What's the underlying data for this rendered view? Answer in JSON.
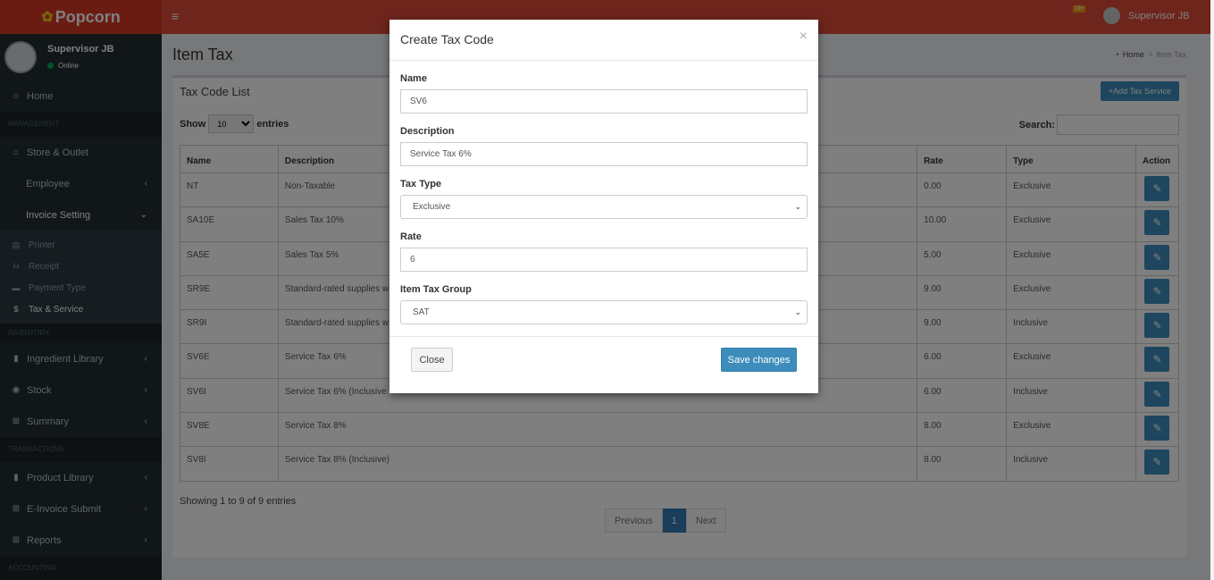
{
  "brand": {
    "name": "Popcorn",
    "icon": "popcorn-icon"
  },
  "topbar": {
    "menu_icon": "≡",
    "badge": "18+",
    "user_name": "Supervisor JB"
  },
  "sidebar": {
    "user": {
      "name": "Supervisor JB",
      "status": "Online"
    },
    "home": "Home",
    "sections": {
      "management": "MANAGEMENT",
      "inventory": "INVENTORY",
      "transactions": "TRANSACTIONS",
      "accounting": "ACCOUNTING"
    },
    "store_outlet": "Store & Outlet",
    "employee": "Employee",
    "invoice_setting": "Invoice Setting",
    "invoice_children": [
      {
        "label": "Printer",
        "icon": "printer-icon"
      },
      {
        "label": "Receipt",
        "icon": "header-icon"
      },
      {
        "label": "Payment Type",
        "icon": "card-icon"
      },
      {
        "label": "Tax & Service",
        "icon": "dollar-icon"
      }
    ],
    "ingredient_library": "Ingredient Library",
    "stock": "Stock",
    "summary": "Summary",
    "product_library": "Product Library",
    "einvoice_submit": "E-Invoice Submit",
    "reports": "Reports"
  },
  "page": {
    "title": "Item Tax",
    "breadcrumb": {
      "home": "Home",
      "sep": ">",
      "current": "Item Tax"
    }
  },
  "list": {
    "title": "Tax Code List",
    "add_button": "Add Tax Service",
    "show_label": "Show",
    "entries_value": "10",
    "entries_label": "entries",
    "search_label": "Search:",
    "columns": [
      "Name",
      "Description",
      "Rate",
      "Type",
      "Action"
    ],
    "rows": [
      {
        "name": "NT",
        "description": "Non-Taxable",
        "rate": "0.00",
        "type": "Exclusive"
      },
      {
        "name": "SA10E",
        "description": "Sales Tax 10%",
        "rate": "10.00",
        "type": "Exclusive"
      },
      {
        "name": "SA5E",
        "description": "Sales Tax 5%",
        "rate": "5.00",
        "type": "Exclusive"
      },
      {
        "name": "SR9E",
        "description": "Standard-rated supplies w",
        "rate": "9.00",
        "type": "Exclusive"
      },
      {
        "name": "SR9I",
        "description": "Standard-rated supplies w",
        "rate": "9.00",
        "type": "Inclusive"
      },
      {
        "name": "SV6E",
        "description": "Service Tax 6%",
        "rate": "6.00",
        "type": "Exclusive"
      },
      {
        "name": "SV6I",
        "description": "Service Tax 6% (Inclusive",
        "rate": "6.00",
        "type": "Inclusive"
      },
      {
        "name": "SV8E",
        "description": "Service Tax 8%",
        "rate": "8.00",
        "type": "Exclusive"
      },
      {
        "name": "SV8I",
        "description": "Service Tax 8% (Inclusive)",
        "rate": "8.00",
        "type": "Inclusive"
      }
    ],
    "info": "Showing 1 to 9 of 9 entries",
    "pagination": {
      "previous": "Previous",
      "current": "1",
      "next": "Next"
    }
  },
  "modal": {
    "title": "Create Tax Code",
    "close_x": "×",
    "fields": {
      "name": {
        "label": "Name",
        "value": "SV6"
      },
      "description": {
        "label": "Description",
        "value": "Service Tax 6%"
      },
      "tax_type": {
        "label": "Tax Type",
        "value": "Exclusive"
      },
      "rate": {
        "label": "Rate",
        "value": "6"
      },
      "item_tax_group": {
        "label": "Item Tax Group",
        "value": "SAT"
      }
    },
    "close_button": "Close",
    "save_button": "Save changes"
  },
  "colors": {
    "header": "#dd4b39",
    "sidebar": "#222d32",
    "primary": "#3c8dbc"
  }
}
